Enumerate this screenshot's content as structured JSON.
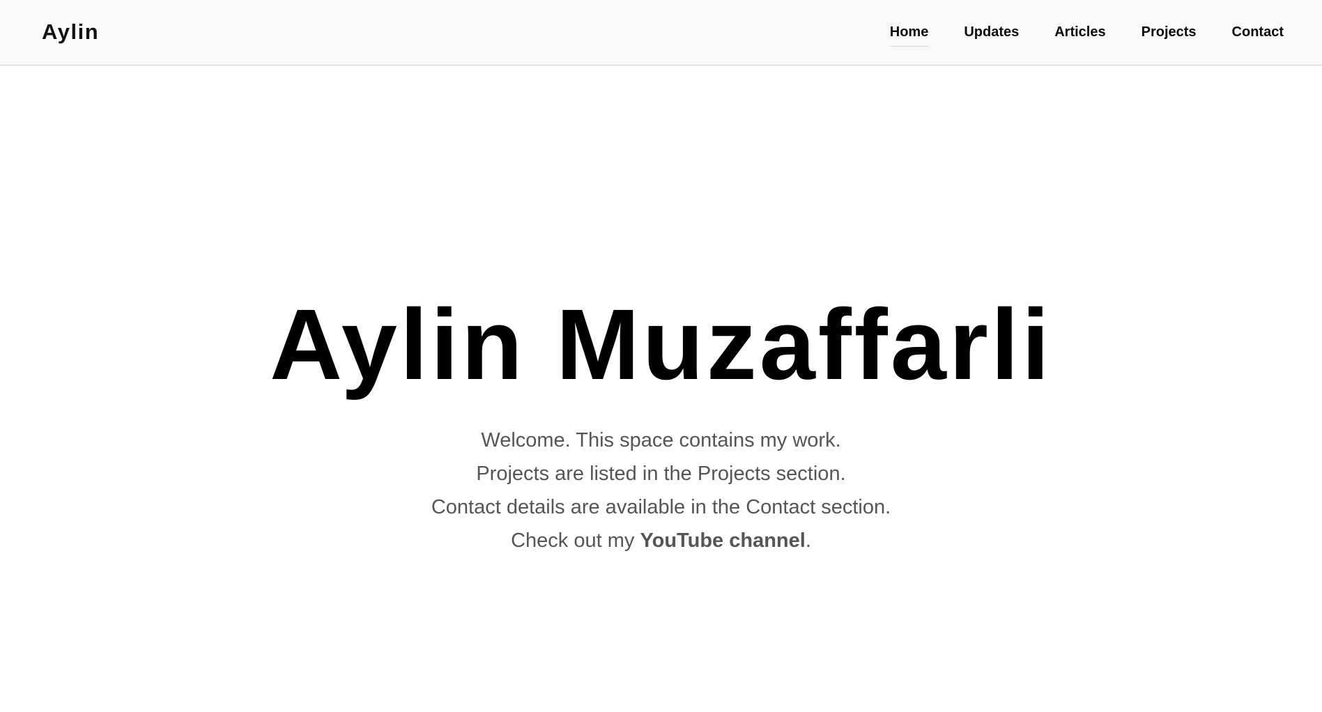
{
  "header": {
    "brand": "Aylin",
    "nav": [
      {
        "label": "Home",
        "active": true
      },
      {
        "label": "Updates",
        "active": false
      },
      {
        "label": "Articles",
        "active": false
      },
      {
        "label": "Projects",
        "active": false
      },
      {
        "label": "Contact",
        "active": false
      }
    ]
  },
  "hero": {
    "title": "Aylin Muzaffarli",
    "lines": [
      "Welcome. This space contains my work.",
      "Projects are listed in the Projects section.",
      "Contact details are available in the Contact section."
    ],
    "youtube_prefix": "Check out my ",
    "youtube_link": "YouTube channel",
    "youtube_suffix": "."
  },
  "colors": {
    "header_bg": "#f9f9f9",
    "text_primary": "#000000",
    "text_muted": "#555555"
  }
}
